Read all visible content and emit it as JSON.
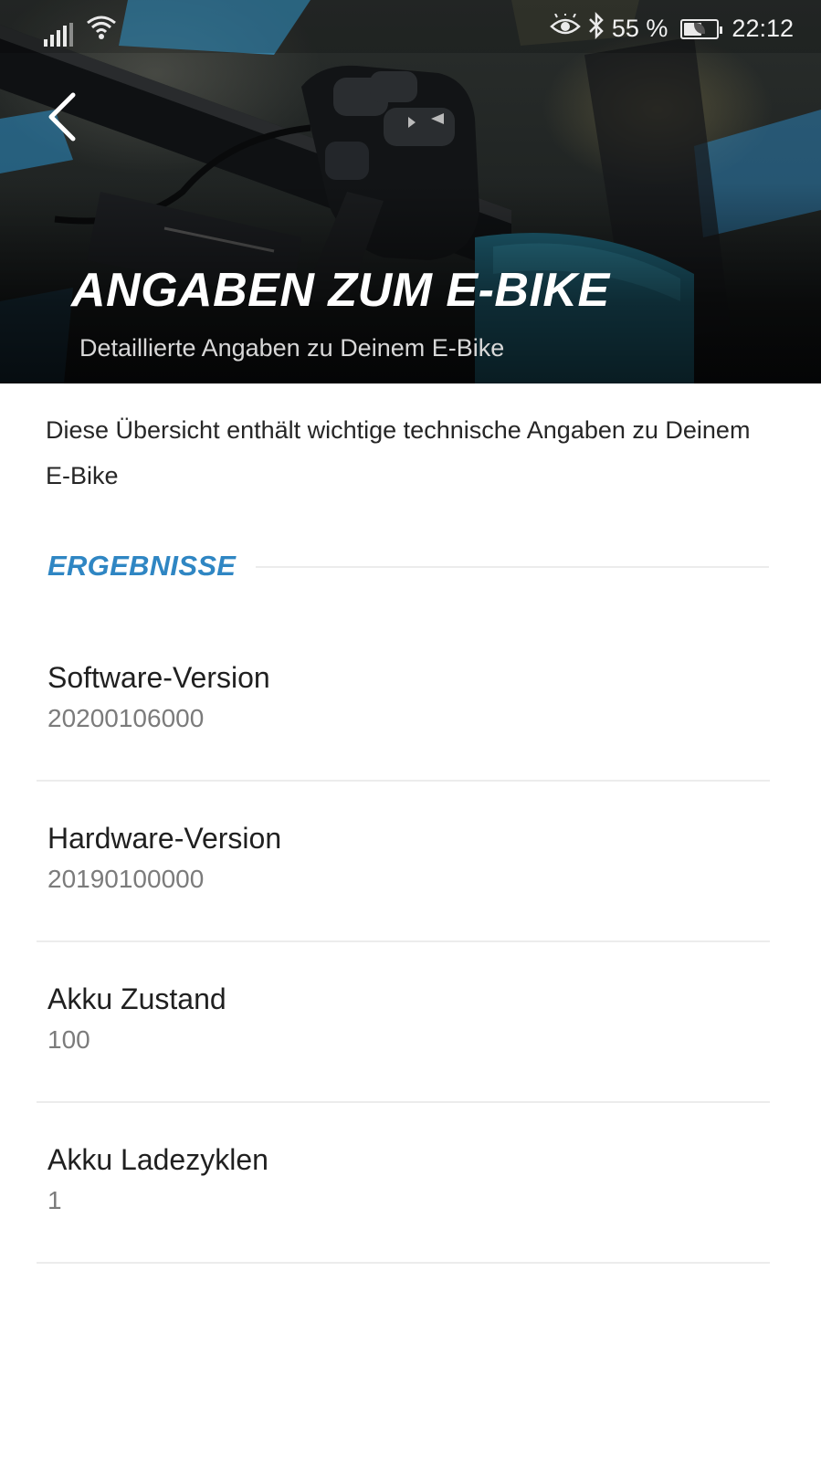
{
  "status_bar": {
    "battery_percent": "55 %",
    "battery_level": 0.55,
    "time": "22:12",
    "icons": [
      "signal-icon",
      "wifi-icon",
      "eye-comfort-icon",
      "bluetooth-icon",
      "battery-saver-icon"
    ]
  },
  "header": {
    "title": "ANGABEN ZUM E-BIKE",
    "subtitle": "Detaillierte Angaben zu Deinem E-Bike",
    "back_icon": "back-arrow-icon"
  },
  "intro_text": "Diese Übersicht enthält wichtige technische Angaben zu Deinem E-Bike",
  "section": {
    "label": "ERGEBNISSE",
    "accent_color": "#2f86c3"
  },
  "results": [
    {
      "title": "Software-Version",
      "value": "20200106000"
    },
    {
      "title": "Hardware-Version",
      "value": "20190100000"
    },
    {
      "title": "Akku Zustand",
      "value": "100"
    },
    {
      "title": "Akku Ladezyklen",
      "value": "1"
    }
  ]
}
